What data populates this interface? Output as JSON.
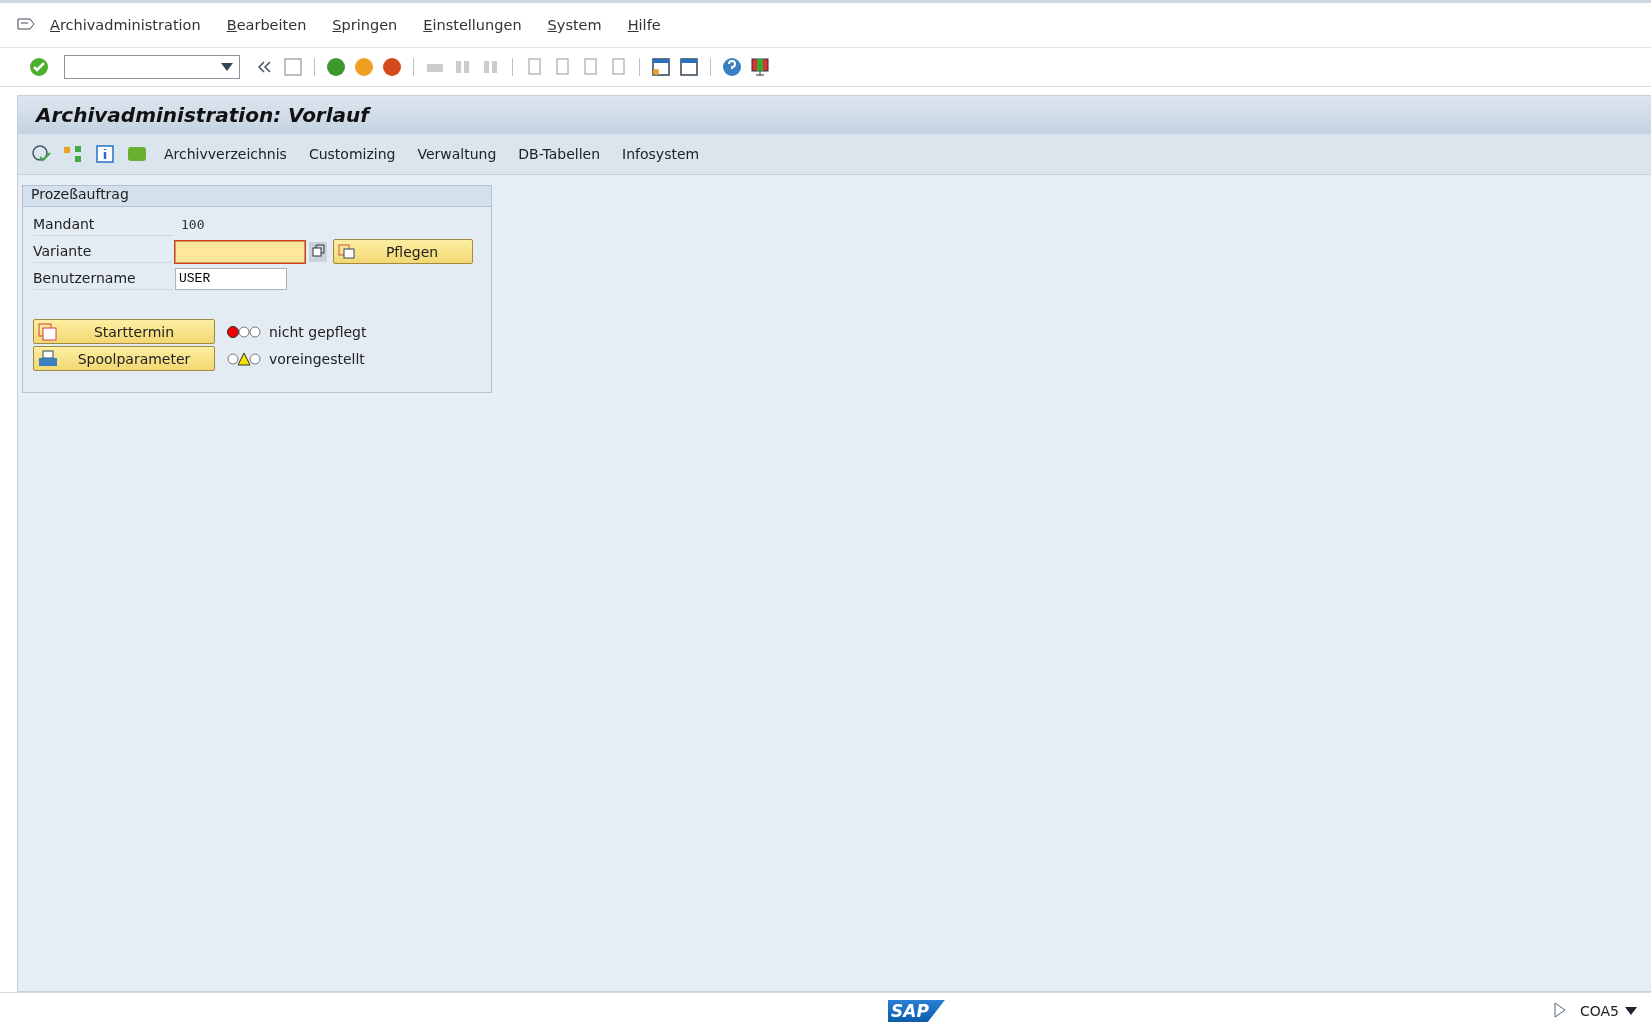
{
  "menu": [
    "Archivadministration",
    "Bearbeiten",
    "Springen",
    "Einstellungen",
    "System",
    "Hilfe"
  ],
  "title": "Archivadministration: Vorlauf",
  "app_toolbar": [
    "Archivverzeichnis",
    "Customizing",
    "Verwaltung",
    "DB-Tabellen",
    "Infosystem"
  ],
  "panel": {
    "title": "Prozeßauftrag",
    "fields": [
      {
        "kind": "display",
        "label": "Mandant",
        "value": "100"
      },
      {
        "kind": "required",
        "label": "Variante",
        "button": "Pflegen"
      },
      {
        "kind": "input",
        "label": "Benutzername",
        "value": "USER"
      }
    ],
    "actions": [
      {
        "button": "Starttermin",
        "kind": "error",
        "status_text": "nicht gepflegt"
      },
      {
        "button": "Spoolparameter",
        "kind": "warning",
        "status_text": "voreingestellt"
      }
    ]
  },
  "status_bar": {
    "logo": "SAP",
    "transaction": "COA5"
  }
}
